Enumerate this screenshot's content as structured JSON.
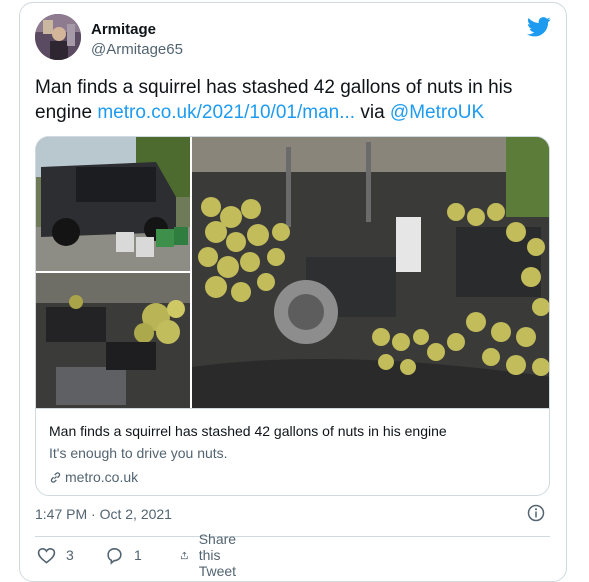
{
  "tweet": {
    "author_name": "Armitage",
    "author_handle": "@Armitage65",
    "text_main": "Man finds a squirrel has stashed 42 gallons of nuts in his engine ",
    "text_link": "metro.co.uk/2021/10/01/man...",
    "text_via": " via ",
    "text_mention": "@MetroUK",
    "timestamp": "1:47 PM · Oct 2, 2021"
  },
  "link_card": {
    "title": "Man finds a squirrel has stashed 42 gallons of nuts in his engine",
    "description": "It's enough to drive you nuts.",
    "domain": "metro.co.uk"
  },
  "actions": {
    "like_count": "3",
    "reply_count": "1",
    "share_label": "Share this Tweet"
  },
  "colors": {
    "accent": "#1d9bf0",
    "secondary_text": "#536471",
    "border": "#cfd9de"
  },
  "icons": [
    "twitter-bird-icon",
    "link-icon",
    "info-icon",
    "heart-icon",
    "reply-icon",
    "share-icon"
  ]
}
